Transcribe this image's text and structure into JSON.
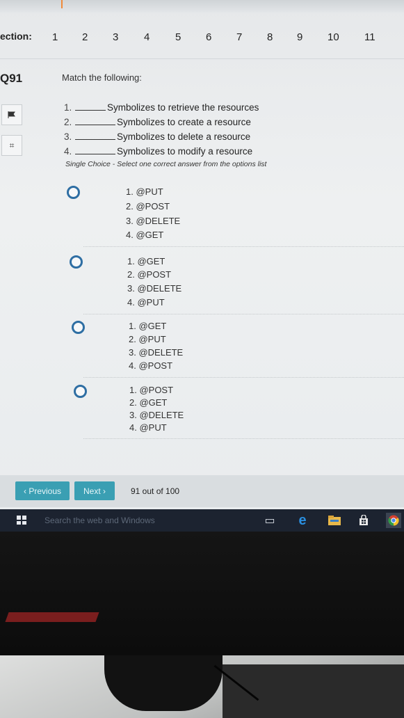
{
  "section_bar": {
    "label": "ection:",
    "numbers": [
      "1",
      "2",
      "3",
      "4",
      "5",
      "6",
      "7",
      "8",
      "9",
      "10",
      "11"
    ]
  },
  "question": {
    "number": "Q91",
    "prompt": "Match the following:",
    "items": [
      {
        "n": "1.",
        "text": "Symbolizes to retrieve the resources"
      },
      {
        "n": "2.",
        "text": "Symbolizes to create a resource"
      },
      {
        "n": "3.",
        "text": "Symbolizes to delete a resource"
      },
      {
        "n": "4.",
        "text": "Symbolizes to modify a resource"
      }
    ],
    "instructions": "Single Choice - Select one correct answer from the options list"
  },
  "options": [
    {
      "lines": [
        "1. @PUT",
        "2. @POST",
        "3. @DELETE",
        "4. @GET"
      ],
      "selected": false
    },
    {
      "lines": [
        "1. @GET",
        "2. @POST",
        "3. @DELETE",
        "4. @PUT"
      ],
      "selected": false
    },
    {
      "lines": [
        "1. @GET",
        "2. @PUT",
        "3. @DELETE",
        "4. @POST"
      ],
      "selected": false
    },
    {
      "lines": [
        "1. @POST",
        "2. @GET",
        "3. @DELETE",
        "4. @PUT"
      ],
      "selected": false
    }
  ],
  "footer": {
    "previous_label": "‹ Previous",
    "next_label": "Next ›",
    "progress": "91 out of 100"
  },
  "taskbar": {
    "search_placeholder": "Search the web and Windows",
    "icons": [
      "windows-start-icon",
      "task-view-icon",
      "edge-browser-icon",
      "file-explorer-icon",
      "store-icon",
      "chrome-icon"
    ]
  },
  "colors": {
    "accent": "#3a9fb3",
    "radio": "#2e6ea3",
    "taskbar": "#1c2330"
  }
}
